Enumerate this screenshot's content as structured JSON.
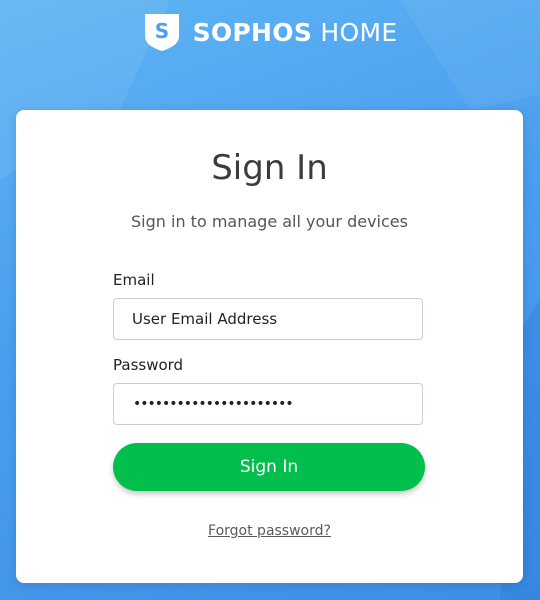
{
  "logo": {
    "brand": "SOPHOS",
    "product": "HOME",
    "shield_letter": "S",
    "icon": "sophos-shield-icon"
  },
  "card": {
    "title": "Sign In",
    "subtitle": "Sign in to manage all your devices"
  },
  "form": {
    "email_label": "Email",
    "email_value": "User Email Address",
    "password_label": "Password",
    "password_masked": "••••••••••••••••••••••",
    "signin_label": "Sign In",
    "forgot_label": "Forgot password?"
  },
  "colors": {
    "background": "#4a9eef",
    "card": "#ffffff",
    "button": "#02be4c",
    "button_text": "#ffffff"
  }
}
